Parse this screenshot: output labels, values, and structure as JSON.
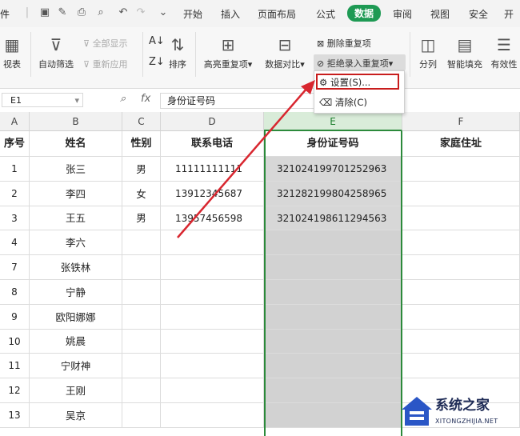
{
  "menubar": {
    "file": "件",
    "tabs": [
      "开始",
      "插入",
      "页面布局",
      "公式",
      "数据",
      "审阅",
      "视图",
      "安全",
      "开"
    ],
    "active_tab": "数据",
    "accent": "#1e9a54"
  },
  "ribbon": {
    "pivot_label": "视表",
    "auto_filter": "自动筛选",
    "show_all": "全部显示",
    "reapply": "重新应用",
    "sort": "排序",
    "highlight_dup": "高亮重复项",
    "data_compare": "数据对比",
    "delete_dup": "删除重复项",
    "reject_dup": "拒绝录入重复项",
    "split": "分列",
    "smart_fill": "智能填充",
    "validity": "有效性"
  },
  "dropdown": {
    "settings": "设置(S)...",
    "clear": "清除(C)"
  },
  "formula_bar": {
    "cell_ref": "E1",
    "fx": "fx",
    "value": "身份证号码"
  },
  "grid": {
    "columns": [
      "A",
      "B",
      "C",
      "D",
      "E",
      "F"
    ],
    "headers": [
      "序号",
      "姓名",
      "性别",
      "联系电话",
      "身份证号码",
      "家庭住址"
    ],
    "rows": [
      {
        "no": "1",
        "name": "张三",
        "gender": "男",
        "phone": "11111111111",
        "id": "321024199701252963"
      },
      {
        "no": "2",
        "name": "李四",
        "gender": "女",
        "phone": "13912345687",
        "id": "321282199804258965"
      },
      {
        "no": "3",
        "name": "王五",
        "gender": "男",
        "phone": "13957456598",
        "id": "321024198611294563"
      },
      {
        "no": "4",
        "name": "李六",
        "gender": "",
        "phone": "",
        "id": ""
      },
      {
        "no": "7",
        "name": "张铁林",
        "gender": "",
        "phone": "",
        "id": ""
      },
      {
        "no": "8",
        "name": "宁静",
        "gender": "",
        "phone": "",
        "id": ""
      },
      {
        "no": "9",
        "name": "欧阳娜娜",
        "gender": "",
        "phone": "",
        "id": ""
      },
      {
        "no": "10",
        "name": "姚晨",
        "gender": "",
        "phone": "",
        "id": ""
      },
      {
        "no": "11",
        "name": "宁财神",
        "gender": "",
        "phone": "",
        "id": ""
      },
      {
        "no": "12",
        "name": "王刚",
        "gender": "",
        "phone": "",
        "id": ""
      },
      {
        "no": "13",
        "name": "吴京",
        "gender": "",
        "phone": "",
        "id": ""
      }
    ]
  },
  "watermark": {
    "name": "系统之家",
    "url": "XITONGZHIJIA.NET"
  }
}
